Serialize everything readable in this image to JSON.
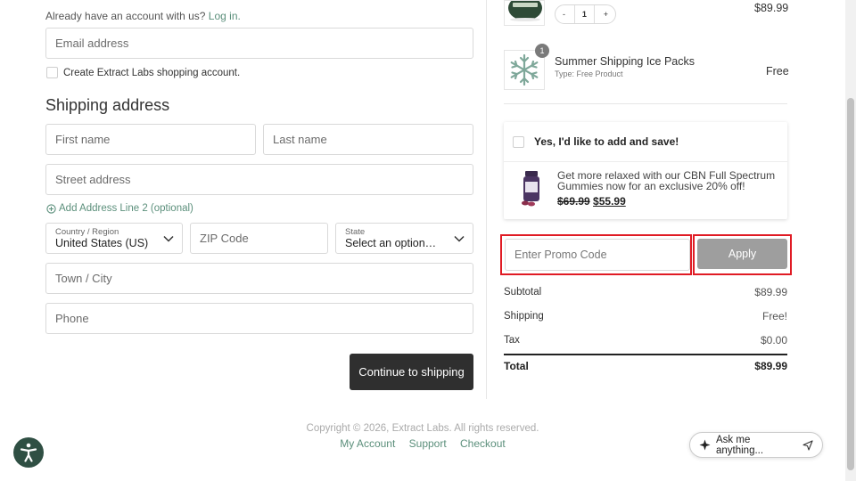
{
  "login": {
    "prompt": "Already have an account with us?",
    "link": "Log in."
  },
  "email": {
    "placeholder": "Email address"
  },
  "create_account": {
    "label": "Create Extract Labs shopping account."
  },
  "shipping": {
    "title": "Shipping address",
    "first_name": "First name",
    "last_name": "Last name",
    "street": "Street address",
    "add_line2": "Add Address Line 2 (optional)",
    "country_label": "Country / Region",
    "country_value": "United States (US)",
    "zip": "ZIP Code",
    "state_label": "State",
    "state_value": "Select an option…",
    "town": "Town / City",
    "phone": "Phone",
    "continue": "Continue to shipping"
  },
  "cart": {
    "item1": {
      "qty_minus": "-",
      "qty": "1",
      "qty_plus": "+",
      "price": "$89.99"
    },
    "item2": {
      "badge": "1",
      "title": "Summer Shipping Ice Packs",
      "type": "Type: Free Product",
      "price": "Free"
    }
  },
  "upsell": {
    "heading": "Yes, I'd like to add and save!",
    "text": "Get more relaxed with our CBN Full Spectrum Gummies now for an exclusive 20% off!",
    "old_price": "$69.99",
    "new_price": "$55.99"
  },
  "promo": {
    "placeholder": "Enter Promo Code",
    "apply": "Apply"
  },
  "summary": {
    "subtotal_label": "Subtotal",
    "subtotal": "$89.99",
    "shipping_label": "Shipping",
    "shipping": "Free!",
    "tax_label": "Tax",
    "tax": "$0.00",
    "total_label": "Total",
    "total": "$89.99"
  },
  "footer": {
    "copyright": "Copyright © 2026, Extract Labs. All rights reserved.",
    "links": [
      "My Account",
      "Support",
      "Checkout"
    ]
  },
  "assistant": {
    "placeholder": "Ask me anything..."
  },
  "colors": {
    "accent": "#5b8f7b",
    "highlight": "#e01b24",
    "dark_button": "#2f2f2f"
  }
}
